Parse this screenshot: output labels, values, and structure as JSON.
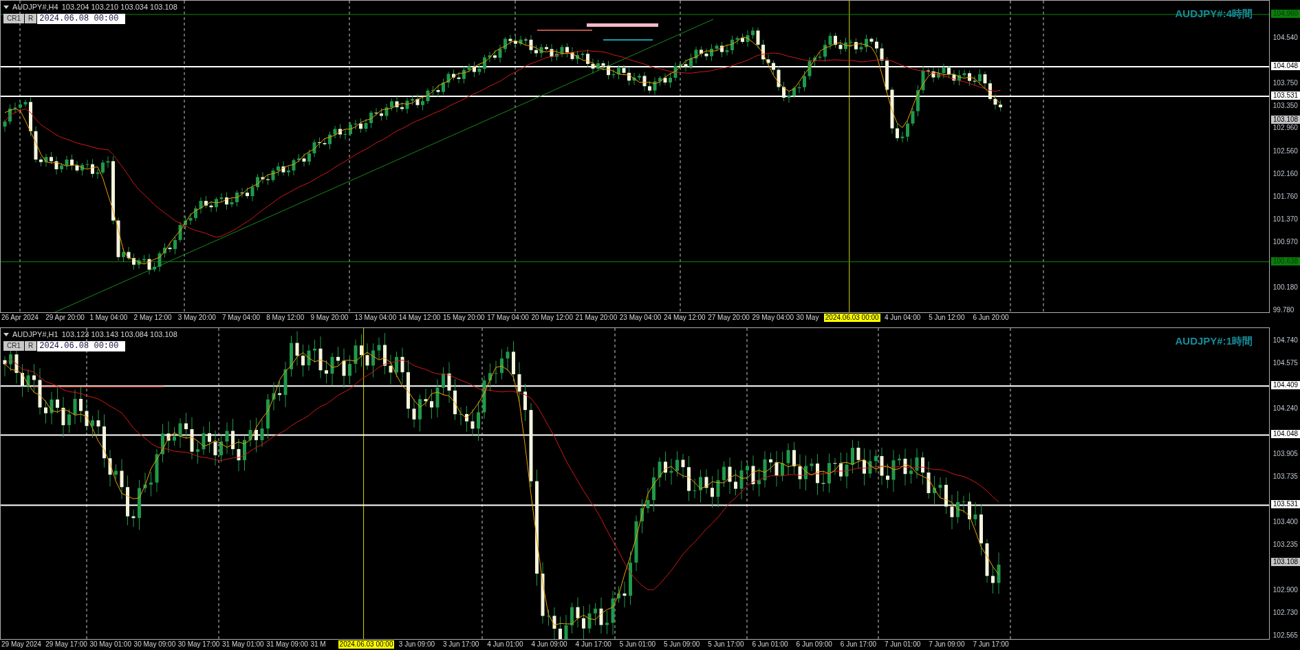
{
  "panels": [
    {
      "symbol": "AUDJPY#,H4",
      "ohlc": "103.204 103.210 103.034 103.108",
      "buttons": [
        {
          "label": "CR1"
        },
        {
          "label": "R"
        }
      ],
      "date_field": "2024.06.08 00:00",
      "title": "AUDJPY#:4時間",
      "price_ticks": [
        "104.540",
        "103.750",
        "103.350",
        "102.960",
        "102.560",
        "102.160",
        "101.760",
        "101.370",
        "100.970",
        "100.180",
        "99.780"
      ],
      "price_labels": [
        {
          "text": "104.960",
          "kind": "alert"
        },
        {
          "text": "104.048",
          "kind": "level"
        },
        {
          "text": "103.531",
          "kind": "level"
        },
        {
          "text": "103.108",
          "kind": "current"
        },
        {
          "text": "100.638",
          "kind": "alert"
        }
      ],
      "time_labels": [
        {
          "text": "26 Apr 2024",
          "kind": "tick"
        },
        {
          "text": "29 Apr 20:00",
          "kind": "tick"
        },
        {
          "text": "1 May 04:00",
          "kind": "tick"
        },
        {
          "text": "2 May 12:00",
          "kind": "tick"
        },
        {
          "text": "3 May 20:00",
          "kind": "tick"
        },
        {
          "text": "7 May 04:00",
          "kind": "tick"
        },
        {
          "text": "8 May 12:00",
          "kind": "tick"
        },
        {
          "text": "9 May 20:00",
          "kind": "tick"
        },
        {
          "text": "13 May 04:00",
          "kind": "tick"
        },
        {
          "text": "14 May 12:00",
          "kind": "tick"
        },
        {
          "text": "15 May 20:00",
          "kind": "tick"
        },
        {
          "text": "17 May 04:00",
          "kind": "tick"
        },
        {
          "text": "20 May 12:00",
          "kind": "tick"
        },
        {
          "text": "21 May 20:00",
          "kind": "tick"
        },
        {
          "text": "23 May 04:00",
          "kind": "tick"
        },
        {
          "text": "24 May 12:00",
          "kind": "tick"
        },
        {
          "text": "27 May 20:00",
          "kind": "tick"
        },
        {
          "text": "29 May 04:00",
          "kind": "tick"
        },
        {
          "text": "30 May",
          "kind": "tick"
        },
        {
          "text": "2024.06.03 00:00",
          "kind": "cursor"
        },
        {
          "text": "4 Jun 04:00",
          "kind": "tick"
        },
        {
          "text": "5 Jun 12:00",
          "kind": "tick"
        },
        {
          "text": "6 Jun 20:00",
          "kind": "tick"
        }
      ]
    },
    {
      "symbol": "AUDJPY#,H1",
      "ohlc": "103.123 103.143 103.084 103.108",
      "buttons": [
        {
          "label": "CR1"
        },
        {
          "label": "R"
        }
      ],
      "date_field": "2024.06.08 00:00",
      "title": "AUDJPY#:1時間",
      "price_ticks": [
        "104.740",
        "104.575",
        "104.240",
        "103.905",
        "103.735",
        "103.400",
        "103.235",
        "102.900",
        "102.730",
        "102.565"
      ],
      "price_labels": [
        {
          "text": "104.409",
          "kind": "level"
        },
        {
          "text": "104.048",
          "kind": "level"
        },
        {
          "text": "103.531",
          "kind": "level"
        },
        {
          "text": "103.108",
          "kind": "current"
        }
      ],
      "time_labels": [
        {
          "text": "29 May 2024",
          "kind": "tick"
        },
        {
          "text": "29 May 17:00",
          "kind": "tick"
        },
        {
          "text": "30 May 01:00",
          "kind": "tick"
        },
        {
          "text": "30 May 09:00",
          "kind": "tick"
        },
        {
          "text": "30 May 17:00",
          "kind": "tick"
        },
        {
          "text": "31 May 01:00",
          "kind": "tick"
        },
        {
          "text": "31 May 09:00",
          "kind": "tick"
        },
        {
          "text": "31 M",
          "kind": "tick"
        },
        {
          "text": "2024.06.03 00:00",
          "kind": "cursor"
        },
        {
          "text": "3 Jun 09:00",
          "kind": "tick"
        },
        {
          "text": "3 Jun 17:00",
          "kind": "tick"
        },
        {
          "text": "4 Jun 01:00",
          "kind": "tick"
        },
        {
          "text": "4 Jun 09:00",
          "kind": "tick"
        },
        {
          "text": "4 Jun 17:00",
          "kind": "tick"
        },
        {
          "text": "5 Jun 01:00",
          "kind": "tick"
        },
        {
          "text": "5 Jun 09:00",
          "kind": "tick"
        },
        {
          "text": "5 Jun 17:00",
          "kind": "tick"
        },
        {
          "text": "6 Jun 01:00",
          "kind": "tick"
        },
        {
          "text": "6 Jun 09:00",
          "kind": "tick"
        },
        {
          "text": "6 Jun 17:00",
          "kind": "tick"
        },
        {
          "text": "7 Jun 01:00",
          "kind": "tick"
        },
        {
          "text": "7 Jun 09:00",
          "kind": "tick"
        },
        {
          "text": "7 Jun 17:00",
          "kind": "tick"
        }
      ]
    }
  ]
}
